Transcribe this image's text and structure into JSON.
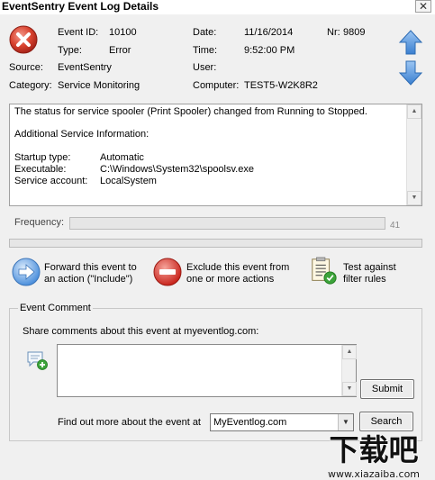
{
  "window": {
    "title": "EventSentry Event Log Details",
    "close_glyph": "✕"
  },
  "event": {
    "event_id_label": "Event ID:",
    "event_id": "10100",
    "type_label": "Type:",
    "type": "Error",
    "source_label": "Source:",
    "source": "EventSentry",
    "category_label": "Category:",
    "category": "Service Monitoring",
    "date_label": "Date:",
    "date": "11/16/2014",
    "time_label": "Time:",
    "time": "9:52:00 PM",
    "user_label": "User:",
    "user": "",
    "computer_label": "Computer:",
    "computer": "TEST5-W2K8R2",
    "nr_label": "Nr:",
    "nr": "9809"
  },
  "message": {
    "line1": "The status for service spooler (Print Spooler) changed from Running to Stopped.",
    "line2": "Additional Service Information:",
    "details": [
      {
        "label": "Startup type:",
        "value": "Automatic"
      },
      {
        "label": "Executable:",
        "value": "C:\\Windows\\System32\\spoolsv.exe"
      },
      {
        "label": "Service account:",
        "value": "LocalSystem"
      }
    ]
  },
  "frequency": {
    "label": "Frequency:",
    "value": "41"
  },
  "actions": {
    "forward_line1": "Forward this event to",
    "forward_line2": "an action (\"Include\")",
    "exclude_line1": "Exclude this event from",
    "exclude_line2": "one or more actions",
    "test_line1": "Test against",
    "test_line2": "filter rules"
  },
  "comment": {
    "group_label": "Event Comment",
    "prompt": "Share comments about this event at myeventlog.com:",
    "text": "",
    "submit_label": "Submit",
    "find_label": "Find out more about the event at",
    "site_selected": "MyEventlog.com",
    "search_label": "Search"
  },
  "watermark": {
    "big": "下载吧",
    "url": "www.xiazaiba.com"
  },
  "colors": {
    "error_red": "#d9432f",
    "arrow_blue": "#4a8fd8",
    "forward_blue": "#4b8fdc",
    "exclude_red": "#d8312b"
  },
  "icons": [
    "error-icon",
    "arrow-up-icon",
    "arrow-down-icon",
    "forward-arrow-icon",
    "exclude-icon",
    "checklist-icon",
    "comment-add-icon"
  ]
}
